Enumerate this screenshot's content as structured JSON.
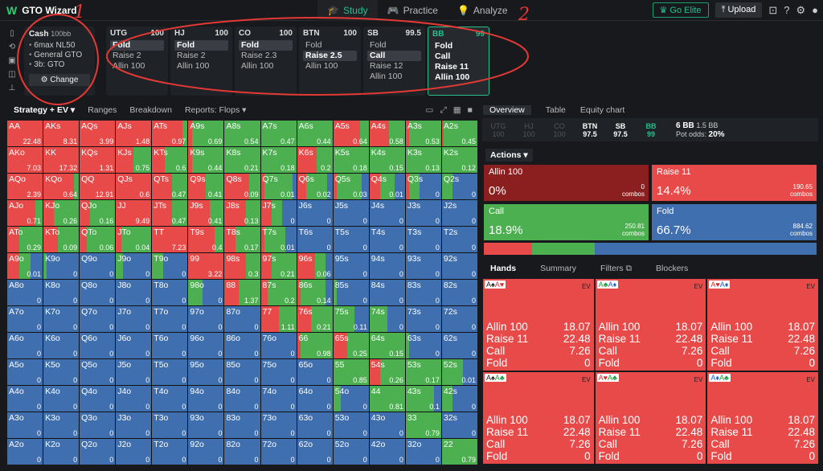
{
  "app": {
    "name": "GTO Wizard"
  },
  "nav": {
    "tabs": [
      {
        "label": "Study",
        "icon": "graduation-cap"
      },
      {
        "label": "Practice",
        "icon": "gamepad"
      },
      {
        "label": "Analyze",
        "icon": "lightbulb"
      }
    ]
  },
  "topright": {
    "elite": "Go Elite",
    "upload": "Upload"
  },
  "config": {
    "title": "Cash",
    "stack": "100bb",
    "items": [
      "6max NL50",
      "General GTO",
      "3b: GTO"
    ],
    "change": "Change"
  },
  "positions": [
    {
      "name": "UTG",
      "stack": "100",
      "actions": [
        "Fold",
        "Raise 2",
        "Allin 100"
      ],
      "selected": 0
    },
    {
      "name": "HJ",
      "stack": "100",
      "actions": [
        "Fold",
        "Raise 2",
        "Allin 100"
      ],
      "selected": 0
    },
    {
      "name": "CO",
      "stack": "100",
      "actions": [
        "Fold",
        "Raise 2.3",
        "Allin 100"
      ],
      "selected": 0
    },
    {
      "name": "BTN",
      "stack": "100",
      "actions": [
        "Fold",
        "Raise 2.5",
        "Allin 100"
      ],
      "selected": 1
    },
    {
      "name": "SB",
      "stack": "99.5",
      "actions": [
        "Fold",
        "Call",
        "Raise 12",
        "Allin 100"
      ],
      "selected": 1
    },
    {
      "name": "BB",
      "stack": "99",
      "actions": [
        "Fold",
        "Call",
        "Raise 11",
        "Allin 100"
      ],
      "selected": -1
    }
  ],
  "subtabs": [
    "Strategy + EV",
    "Ranges",
    "Breakdown",
    "Reports: Flops"
  ],
  "colors": {
    "allin": "#8b1e1e",
    "raise": "#e84a4a",
    "call": "#4caf50",
    "fold": "#3f6fae"
  },
  "grid": [
    [
      "AA",
      "22.48",
      0,
      1,
      0,
      0
    ],
    [
      "AKs",
      "8.31",
      0,
      1,
      0,
      0
    ],
    [
      "AQs",
      "3.99",
      0,
      1,
      0,
      0
    ],
    [
      "AJs",
      "1.48",
      0,
      1,
      0,
      0
    ],
    [
      "ATs",
      "0.97",
      0,
      0.85,
      0.15,
      0
    ],
    [
      "A9s",
      "0.69",
      0,
      0.1,
      0.9,
      0
    ],
    [
      "A8s",
      "0.54",
      0,
      0,
      1,
      0
    ],
    [
      "A7s",
      "0.47",
      0,
      0,
      1,
      0
    ],
    [
      "A6s",
      "0.44",
      0,
      0,
      1,
      0
    ],
    [
      "A5s",
      "0.64",
      0,
      0.75,
      0.25,
      0
    ],
    [
      "A4s",
      "0.58",
      0,
      0.55,
      0.45,
      0
    ],
    [
      "A3s",
      "0.53",
      0,
      0.1,
      0.9,
      0
    ],
    [
      "A2s",
      "0.45",
      0,
      0.05,
      0.95,
      0
    ],
    [
      "AKo",
      "7.03",
      0,
      1,
      0,
      0
    ],
    [
      "KK",
      "17.32",
      0,
      1,
      0,
      0
    ],
    [
      "KQs",
      "1.31",
      0,
      1,
      0,
      0
    ],
    [
      "KJs",
      "0.75",
      0,
      0.5,
      0.5,
      0
    ],
    [
      "KTs",
      "0.6",
      0,
      0.35,
      0.65,
      0
    ],
    [
      "K9s",
      "0.44",
      0,
      0.1,
      0.9,
      0
    ],
    [
      "K8s",
      "0.21",
      0,
      0,
      1,
      0
    ],
    [
      "K7s",
      "0.18",
      0,
      0,
      1,
      0
    ],
    [
      "K6s",
      "0.2",
      0,
      0.55,
      0.45,
      0
    ],
    [
      "K5s",
      "0.18",
      0,
      0,
      1,
      0
    ],
    [
      "K4s",
      "0.15",
      0,
      0,
      1,
      0
    ],
    [
      "K3s",
      "0.13",
      0,
      0,
      1,
      0
    ],
    [
      "K2s",
      "0.12",
      0,
      0,
      1,
      0
    ],
    [
      "AQo",
      "2.39",
      0,
      1,
      0,
      0
    ],
    [
      "KQo",
      "0.64",
      0,
      0.85,
      0.15,
      0
    ],
    [
      "QQ",
      "12.91",
      0,
      1,
      0,
      0
    ],
    [
      "QJs",
      "0.6",
      0,
      1,
      0,
      0
    ],
    [
      "QTs",
      "0.47",
      0,
      0.55,
      0.45,
      0
    ],
    [
      "Q9s",
      "0.41",
      0,
      0.5,
      0.5,
      0
    ],
    [
      "Q8s",
      "0.09",
      0,
      0.7,
      0.3,
      0
    ],
    [
      "Q7s",
      "0.01",
      0,
      0.1,
      0.8,
      0.1
    ],
    [
      "Q6s",
      "0.02",
      0,
      0.25,
      0.6,
      0.15
    ],
    [
      "Q5s",
      "0.03",
      0,
      0.1,
      0.7,
      0.2
    ],
    [
      "Q4s",
      "0.01",
      0,
      0.3,
      0.4,
      0.3
    ],
    [
      "Q3s",
      "0",
      0,
      0.1,
      0.3,
      0.6
    ],
    [
      "Q2s",
      "0",
      0,
      0,
      0.3,
      0.7
    ],
    [
      "AJo",
      "0.71",
      0,
      0.8,
      0.2,
      0
    ],
    [
      "KJo",
      "0.26",
      0,
      0.3,
      0.7,
      0
    ],
    [
      "QJo",
      "0.16",
      0,
      0.3,
      0.7,
      0
    ],
    [
      "JJ",
      "9.49",
      0,
      1,
      0,
      0
    ],
    [
      "JTs",
      "0.47",
      0,
      0.55,
      0.45,
      0
    ],
    [
      "J9s",
      "0.41",
      0,
      0.6,
      0.4,
      0
    ],
    [
      "J8s",
      "0.13",
      0,
      0.6,
      0.4,
      0
    ],
    [
      "J7s",
      "0",
      0,
      0.3,
      0.3,
      0.4
    ],
    [
      "J6s",
      "0",
      0,
      0,
      0,
      1
    ],
    [
      "J5s",
      "0",
      0,
      0,
      0,
      1
    ],
    [
      "J4s",
      "0",
      0,
      0,
      0,
      1
    ],
    [
      "J3s",
      "0",
      0,
      0,
      0,
      1
    ],
    [
      "J2s",
      "0",
      0,
      0,
      0,
      1
    ],
    [
      "ATo",
      "0.29",
      0,
      0.35,
      0.65,
      0
    ],
    [
      "KTo",
      "0.09",
      0,
      0.4,
      0.6,
      0
    ],
    [
      "QTo",
      "0.06",
      0,
      0.2,
      0.8,
      0
    ],
    [
      "JTo",
      "0.04",
      0,
      0.15,
      0.85,
      0
    ],
    [
      "TT",
      "7.23",
      0,
      1,
      0,
      0
    ],
    [
      "T9s",
      "0.4",
      0,
      0.75,
      0.25,
      0
    ],
    [
      "T8s",
      "0.17",
      0,
      0.3,
      0.7,
      0
    ],
    [
      "T7s",
      "0.01",
      0,
      0.1,
      0.6,
      0.3
    ],
    [
      "T6s",
      "0",
      0,
      0,
      0,
      1
    ],
    [
      "T5s",
      "0",
      0,
      0,
      0,
      1
    ],
    [
      "T4s",
      "0",
      0,
      0,
      0,
      1
    ],
    [
      "T3s",
      "0",
      0,
      0,
      0,
      1
    ],
    [
      "T2s",
      "0",
      0,
      0,
      0,
      1
    ],
    [
      "A9o",
      "0.01",
      0,
      0.35,
      0.3,
      0.35
    ],
    [
      "K9o",
      "0",
      0,
      0,
      0.1,
      0.9
    ],
    [
      "Q9o",
      "0",
      0,
      0,
      0,
      1
    ],
    [
      "J9o",
      "0",
      0,
      0,
      0.2,
      0.8
    ],
    [
      "T9o",
      "0",
      0,
      0,
      0.3,
      0.7
    ],
    [
      "99",
      "3.22",
      0,
      1,
      0,
      0
    ],
    [
      "98s",
      "0.3",
      0,
      0.6,
      0.4,
      0
    ],
    [
      "97s",
      "0.21",
      0,
      0.3,
      0.7,
      0
    ],
    [
      "96s",
      "0.06",
      0,
      0.5,
      0.3,
      0.2
    ],
    [
      "95s",
      "0",
      0,
      0,
      0,
      1
    ],
    [
      "94s",
      "0",
      0,
      0,
      0,
      1
    ],
    [
      "93s",
      "0",
      0,
      0,
      0,
      1
    ],
    [
      "92s",
      "0",
      0,
      0,
      0,
      1
    ],
    [
      "A8o",
      "0",
      0,
      0,
      0,
      1
    ],
    [
      "K8o",
      "0",
      0,
      0,
      0,
      1
    ],
    [
      "Q8o",
      "0",
      0,
      0,
      0,
      1
    ],
    [
      "J8o",
      "0",
      0,
      0,
      0,
      1
    ],
    [
      "T8o",
      "0",
      0,
      0,
      0,
      1
    ],
    [
      "98o",
      "0",
      0,
      0,
      0.4,
      0.6
    ],
    [
      "88",
      "1.37",
      0,
      0.4,
      0.6,
      0
    ],
    [
      "87s",
      "0.2",
      0,
      0.2,
      0.8,
      0
    ],
    [
      "86s",
      "0.14",
      0,
      0.1,
      0.7,
      0.2
    ],
    [
      "85s",
      "0",
      0,
      0,
      0.1,
      0.9
    ],
    [
      "84s",
      "0",
      0,
      0,
      0,
      1
    ],
    [
      "83s",
      "0",
      0,
      0,
      0,
      1
    ],
    [
      "82s",
      "0",
      0,
      0,
      0,
      1
    ],
    [
      "A7o",
      "0",
      0,
      0,
      0,
      1
    ],
    [
      "K7o",
      "0",
      0,
      0,
      0,
      1
    ],
    [
      "Q7o",
      "0",
      0,
      0,
      0,
      1
    ],
    [
      "J7o",
      "0",
      0,
      0,
      0,
      1
    ],
    [
      "T7o",
      "0",
      0,
      0,
      0,
      1
    ],
    [
      "97o",
      "0",
      0,
      0,
      0,
      1
    ],
    [
      "87o",
      "0",
      0,
      0,
      0,
      1
    ],
    [
      "77",
      "1.11",
      0,
      0.5,
      0.5,
      0
    ],
    [
      "76s",
      "0.21",
      0,
      0.4,
      0.6,
      0
    ],
    [
      "75s",
      "0.11",
      0,
      0,
      0.6,
      0.4
    ],
    [
      "74s",
      "0",
      0,
      0,
      0.5,
      0.5
    ],
    [
      "73s",
      "0",
      0,
      0,
      0,
      1
    ],
    [
      "72s",
      "0",
      0,
      0,
      0,
      1
    ],
    [
      "A6o",
      "0",
      0,
      0,
      0,
      1
    ],
    [
      "K6o",
      "0",
      0,
      0,
      0,
      1
    ],
    [
      "Q6o",
      "0",
      0,
      0,
      0,
      1
    ],
    [
      "J6o",
      "0",
      0,
      0,
      0,
      1
    ],
    [
      "T6o",
      "0",
      0,
      0,
      0,
      1
    ],
    [
      "96o",
      "0",
      0,
      0,
      0,
      1
    ],
    [
      "86o",
      "0",
      0,
      0,
      0,
      1
    ],
    [
      "76o",
      "0",
      0,
      0,
      0,
      1
    ],
    [
      "66",
      "0.98",
      0,
      0.1,
      0.9,
      0
    ],
    [
      "65s",
      "0.25",
      0,
      0.4,
      0.6,
      0
    ],
    [
      "64s",
      "0.15",
      0,
      0,
      1,
      0
    ],
    [
      "63s",
      "0",
      0,
      0,
      0.1,
      0.9
    ],
    [
      "62s",
      "0",
      0,
      0,
      0,
      1
    ],
    [
      "A5o",
      "0",
      0,
      0,
      0,
      1
    ],
    [
      "K5o",
      "0",
      0,
      0,
      0,
      1
    ],
    [
      "Q5o",
      "0",
      0,
      0,
      0,
      1
    ],
    [
      "J5o",
      "0",
      0,
      0,
      0,
      1
    ],
    [
      "T5o",
      "0",
      0,
      0,
      0,
      1
    ],
    [
      "95o",
      "0",
      0,
      0,
      0,
      1
    ],
    [
      "85o",
      "0",
      0,
      0,
      0,
      1
    ],
    [
      "75o",
      "0",
      0,
      0,
      0,
      1
    ],
    [
      "65o",
      "0",
      0,
      0,
      0,
      1
    ],
    [
      "55",
      "0.85",
      0,
      0,
      1,
      0
    ],
    [
      "54s",
      "0.26",
      0,
      0.3,
      0.7,
      0
    ],
    [
      "53s",
      "0.17",
      0,
      0,
      1,
      0
    ],
    [
      "52s",
      "0.01",
      0,
      0,
      0.6,
      0.4
    ],
    [
      "A4o",
      "0",
      0,
      0,
      0,
      1
    ],
    [
      "K4o",
      "0",
      0,
      0,
      0,
      1
    ],
    [
      "Q4o",
      "0",
      0,
      0,
      0,
      1
    ],
    [
      "J4o",
      "0",
      0,
      0,
      0,
      1
    ],
    [
      "T4o",
      "0",
      0,
      0,
      0,
      1
    ],
    [
      "94o",
      "0",
      0,
      0,
      0,
      1
    ],
    [
      "84o",
      "0",
      0,
      0,
      0,
      1
    ],
    [
      "74o",
      "0",
      0,
      0,
      0,
      1
    ],
    [
      "64o",
      "0",
      0,
      0,
      0,
      1
    ],
    [
      "54o",
      "0",
      0,
      0,
      0.2,
      0.8
    ],
    [
      "44",
      "0.81",
      0,
      0,
      1,
      0
    ],
    [
      "43s",
      "0.1",
      0,
      0,
      0.8,
      0.2
    ],
    [
      "42s",
      "0",
      0,
      0,
      0.3,
      0.7
    ],
    [
      "A3o",
      "0",
      0,
      0,
      0,
      1
    ],
    [
      "K3o",
      "0",
      0,
      0,
      0,
      1
    ],
    [
      "Q3o",
      "0",
      0,
      0,
      0,
      1
    ],
    [
      "J3o",
      "0",
      0,
      0,
      0,
      1
    ],
    [
      "T3o",
      "0",
      0,
      0,
      0,
      1
    ],
    [
      "93o",
      "0",
      0,
      0,
      0,
      1
    ],
    [
      "83o",
      "0",
      0,
      0,
      0,
      1
    ],
    [
      "73o",
      "0",
      0,
      0,
      0,
      1
    ],
    [
      "63o",
      "0",
      0,
      0,
      0,
      1
    ],
    [
      "53o",
      "0",
      0,
      0,
      0,
      1
    ],
    [
      "43o",
      "0",
      0,
      0,
      0,
      1
    ],
    [
      "33",
      "0.79",
      0,
      0,
      1,
      0
    ],
    [
      "32s",
      "0",
      0,
      0,
      0,
      1
    ],
    [
      "A2o",
      "0",
      0,
      0,
      0,
      1
    ],
    [
      "K2o",
      "0",
      0,
      0,
      0,
      1
    ],
    [
      "Q2o",
      "0",
      0,
      0,
      0,
      1
    ],
    [
      "J2o",
      "0",
      0,
      0,
      0,
      1
    ],
    [
      "T2o",
      "0",
      0,
      0,
      0,
      1
    ],
    [
      "92o",
      "0",
      0,
      0,
      0,
      1
    ],
    [
      "82o",
      "0",
      0,
      0,
      0,
      1
    ],
    [
      "72o",
      "0",
      0,
      0,
      0,
      1
    ],
    [
      "62o",
      "0",
      0,
      0,
      0,
      1
    ],
    [
      "52o",
      "0",
      0,
      0,
      0,
      1
    ],
    [
      "42o",
      "0",
      0,
      0,
      0,
      1
    ],
    [
      "32o",
      "0",
      0,
      0,
      0,
      1
    ],
    [
      "22",
      "0.79",
      0,
      0,
      1,
      0
    ]
  ],
  "right": {
    "tabs": [
      "Overview",
      "Table",
      "Equity chart"
    ],
    "seats": [
      {
        "n": "UTG",
        "s": "100"
      },
      {
        "n": "HJ",
        "s": "100"
      },
      {
        "n": "CO",
        "s": "100"
      },
      {
        "n": "BTN",
        "s": "97.5"
      },
      {
        "n": "SB",
        "s": "97.5"
      },
      {
        "n": "BB",
        "s": "99"
      }
    ],
    "pot": {
      "bb": "6 BB",
      "bbsmall": "1.5 BB",
      "odds_label": "Pot odds:",
      "odds": "20%"
    },
    "actions_label": "Actions",
    "actions": [
      {
        "name": "Allin 100",
        "pct": "0%",
        "combos": "0",
        "color": "#8b1e1e"
      },
      {
        "name": "Raise 11",
        "pct": "14.4%",
        "combos": "190.65",
        "color": "#e84a4a"
      },
      {
        "name": "Call",
        "pct": "18.9%",
        "combos": "250.81",
        "color": "#4caf50"
      },
      {
        "name": "Fold",
        "pct": "66.7%",
        "combos": "884.62",
        "color": "#3f6fae"
      }
    ],
    "freq": [
      0,
      14.4,
      18.9,
      66.7
    ],
    "combos_label": "combos",
    "hand_tabs": [
      "Hands",
      "Summary",
      "Filters",
      "Blockers"
    ],
    "ev_label": "EV",
    "combos": [
      {
        "c1": "A",
        "s1": "♠",
        "k1": "blk",
        "c2": "A",
        "s2": "♥",
        "k2": "red"
      },
      {
        "c1": "A",
        "s1": "♣",
        "k1": "grn",
        "c2": "A",
        "s2": "♦",
        "k2": "blu"
      },
      {
        "c1": "A",
        "s1": "♥",
        "k1": "red",
        "c2": "A",
        "s2": "♦",
        "k2": "blu"
      },
      {
        "c1": "A",
        "s1": "♠",
        "k1": "blk",
        "c2": "A",
        "s2": "♣",
        "k2": "grn"
      },
      {
        "c1": "A",
        "s1": "♥",
        "k1": "red",
        "c2": "A",
        "s2": "♣",
        "k2": "grn"
      },
      {
        "c1": "A",
        "s1": "♦",
        "k1": "blu",
        "c2": "A",
        "s2": "♣",
        "k2": "grn"
      }
    ],
    "combo_rows": [
      [
        "Allin 100",
        "18.07"
      ],
      [
        "Raise 11",
        "22.48"
      ],
      [
        "Call",
        "7.26"
      ],
      [
        "Fold",
        "0"
      ]
    ]
  },
  "annotations": [
    "1",
    "2"
  ]
}
